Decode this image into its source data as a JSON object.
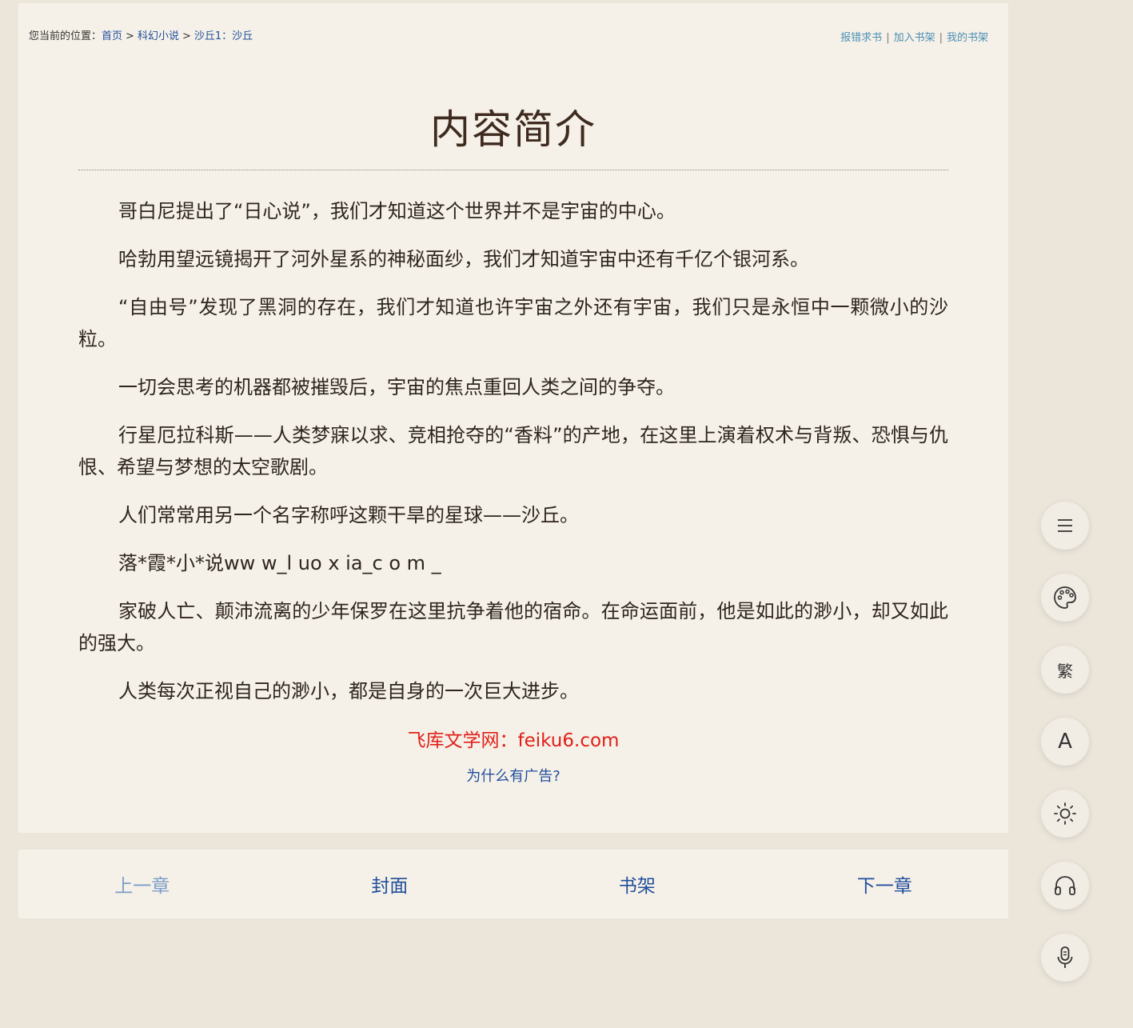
{
  "breadcrumb": {
    "prefix": "您当前的位置：",
    "items": [
      "首页",
      "科幻小说",
      "沙丘1：沙丘"
    ],
    "separator": ">"
  },
  "top_links": [
    "报错求书",
    "加入书架",
    "我的书架"
  ],
  "chapter": {
    "title": "内容简介",
    "paragraphs": [
      "哥白尼提出了“日心说”，我们才知道这个世界并不是宇宙的中心。",
      "哈勃用望远镜揭开了河外星系的神秘面纱，我们才知道宇宙中还有千亿个银河系。",
      "“自由号”发现了黑洞的存在，我们才知道也许宇宙之外还有宇宙，我们只是永恒中一颗微小的沙粒。",
      "一切会思考的机器都被摧毁后，宇宙的焦点重回人类之间的争夺。",
      "行星厄拉科斯——人类梦寐以求、竞相抢夺的“香料”的产地，在这里上演着权术与背叛、恐惧与仇恨、希望与梦想的太空歌剧。",
      "人们常常用另一个名字称呼这颗干旱的星球——沙丘。",
      "落*霞*小*说ww w_l uo x ia_c o m _",
      "家破人亡、颠沛流离的少年保罗在这里抗争着他的宿命。在命运面前，他是如此的渺小，却又如此的强大。",
      "人类每次正视自己的渺小，都是自身的一次巨大进步。"
    ]
  },
  "ad": {
    "text": "飞库文学网：feiku6.com",
    "why": "为什么有广告?"
  },
  "nav": {
    "prev": "上一章",
    "cover": "封面",
    "shelf": "书架",
    "next": "下一章"
  },
  "tools": {
    "traditional_label": "繁",
    "font_label": "A",
    "icons": [
      "menu-icon",
      "palette-icon",
      "traditional-chinese-icon",
      "font-size-icon",
      "brightness-icon",
      "headphones-icon",
      "microphone-icon"
    ]
  },
  "colors": {
    "background": "#ebe5da",
    "panel": "#f6f1e8",
    "link": "#1f4e9c",
    "ad_red": "#e0201a",
    "title": "#3e2a1e"
  }
}
